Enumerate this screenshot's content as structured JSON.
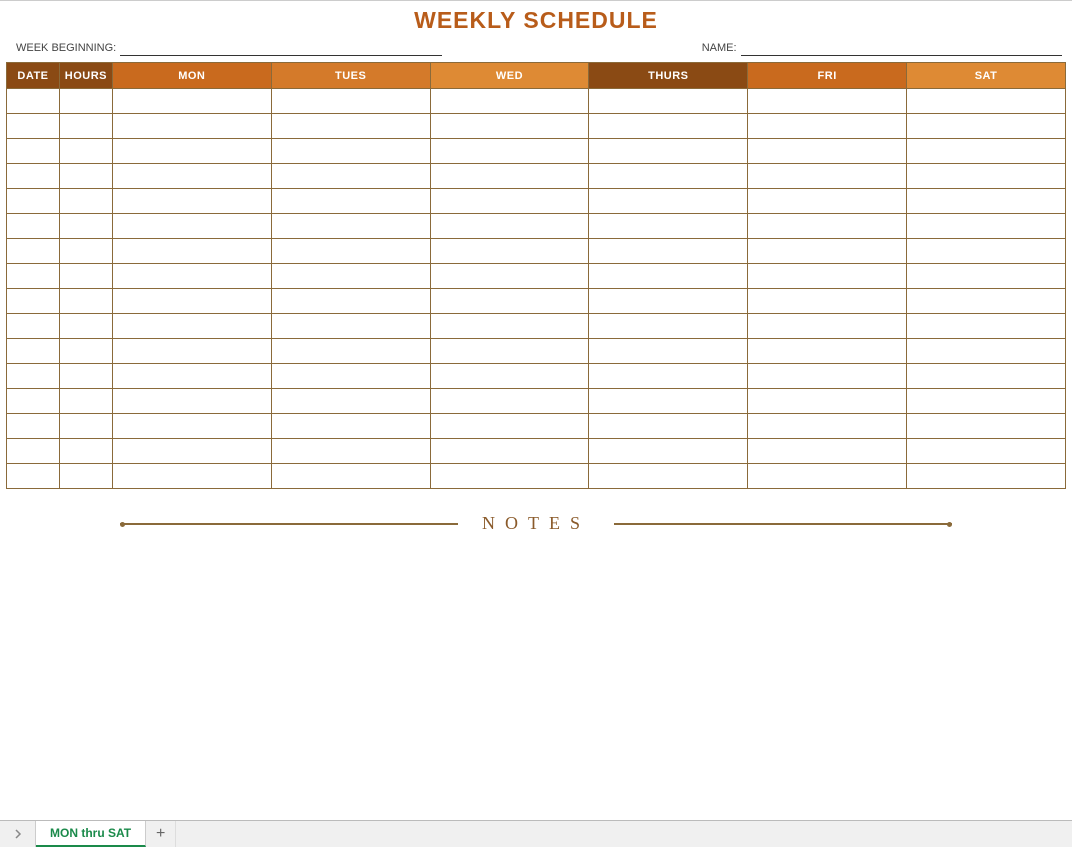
{
  "title": "WEEKLY SCHEDULE",
  "meta": {
    "week_beginning_label": "WEEK BEGINNING:",
    "week_beginning_value": "",
    "name_label": "NAME:",
    "name_value": ""
  },
  "columns": {
    "date": "DATE",
    "hours": "HOURS",
    "mon": "MON",
    "tues": "TUES",
    "wed": "WED",
    "thurs": "THURS",
    "fri": "FRI",
    "sat": "SAT"
  },
  "rows": [
    {
      "date": "",
      "hours": "",
      "mon": "",
      "tues": "",
      "wed": "",
      "thurs": "",
      "fri": "",
      "sat": ""
    },
    {
      "date": "",
      "hours": "",
      "mon": "",
      "tues": "",
      "wed": "",
      "thurs": "",
      "fri": "",
      "sat": ""
    },
    {
      "date": "",
      "hours": "",
      "mon": "",
      "tues": "",
      "wed": "",
      "thurs": "",
      "fri": "",
      "sat": ""
    },
    {
      "date": "",
      "hours": "",
      "mon": "",
      "tues": "",
      "wed": "",
      "thurs": "",
      "fri": "",
      "sat": ""
    },
    {
      "date": "",
      "hours": "",
      "mon": "",
      "tues": "",
      "wed": "",
      "thurs": "",
      "fri": "",
      "sat": ""
    },
    {
      "date": "",
      "hours": "",
      "mon": "",
      "tues": "",
      "wed": "",
      "thurs": "",
      "fri": "",
      "sat": ""
    },
    {
      "date": "",
      "hours": "",
      "mon": "",
      "tues": "",
      "wed": "",
      "thurs": "",
      "fri": "",
      "sat": ""
    },
    {
      "date": "",
      "hours": "",
      "mon": "",
      "tues": "",
      "wed": "",
      "thurs": "",
      "fri": "",
      "sat": ""
    },
    {
      "date": "",
      "hours": "",
      "mon": "",
      "tues": "",
      "wed": "",
      "thurs": "",
      "fri": "",
      "sat": ""
    },
    {
      "date": "",
      "hours": "",
      "mon": "",
      "tues": "",
      "wed": "",
      "thurs": "",
      "fri": "",
      "sat": ""
    },
    {
      "date": "",
      "hours": "",
      "mon": "",
      "tues": "",
      "wed": "",
      "thurs": "",
      "fri": "",
      "sat": ""
    },
    {
      "date": "",
      "hours": "",
      "mon": "",
      "tues": "",
      "wed": "",
      "thurs": "",
      "fri": "",
      "sat": ""
    },
    {
      "date": "",
      "hours": "",
      "mon": "",
      "tues": "",
      "wed": "",
      "thurs": "",
      "fri": "",
      "sat": ""
    },
    {
      "date": "",
      "hours": "",
      "mon": "",
      "tues": "",
      "wed": "",
      "thurs": "",
      "fri": "",
      "sat": ""
    },
    {
      "date": "",
      "hours": "",
      "mon": "",
      "tues": "",
      "wed": "",
      "thurs": "",
      "fri": "",
      "sat": ""
    },
    {
      "date": "",
      "hours": "",
      "mon": "",
      "tues": "",
      "wed": "",
      "thurs": "",
      "fri": "",
      "sat": ""
    }
  ],
  "notes_label": "NOTES",
  "tabs": {
    "active": "MON thru SAT",
    "add_symbol": "+"
  }
}
